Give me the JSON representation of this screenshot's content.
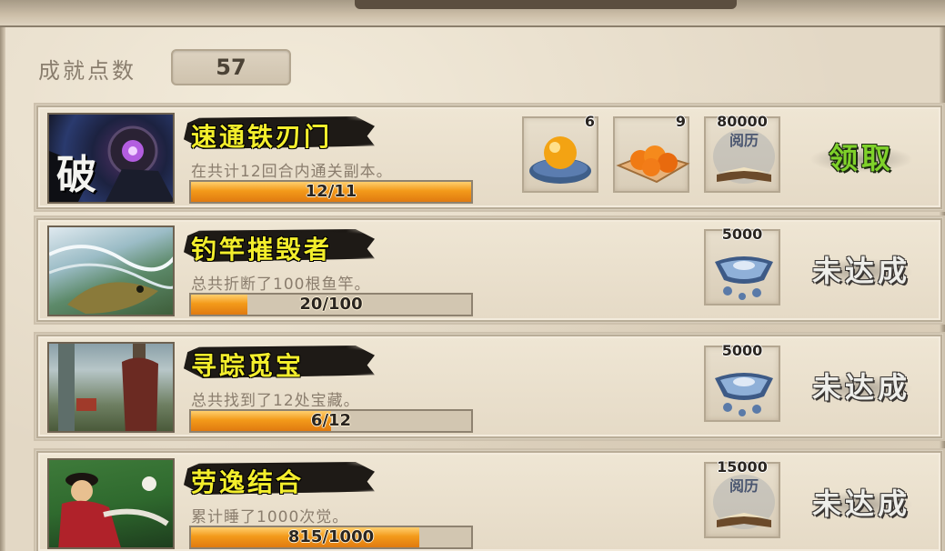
{
  "header": {
    "points_label": "成就点数",
    "points_value": "57"
  },
  "achievements": [
    {
      "title": "速通铁刃门",
      "description": "在共计12回合内通关副本。",
      "progress_text": "12/11",
      "progress": 1.0,
      "rewards": [
        {
          "icon": "orange-orb-icon",
          "count": "6"
        },
        {
          "icon": "oranges-plate-icon",
          "count": "9"
        },
        {
          "icon": "experience-book-icon",
          "count": "80000"
        }
      ],
      "action_label": "领取",
      "action_state": "claimable",
      "portrait_text": "破"
    },
    {
      "title": "钓竿摧毁者",
      "description": "总共折断了100根鱼竿。",
      "progress_text": "20/100",
      "progress": 0.2,
      "rewards": [
        {
          "icon": "silver-ingot-icon",
          "count": "5000"
        }
      ],
      "action_label": "未达成",
      "action_state": "locked"
    },
    {
      "title": "寻踪觅宝",
      "description": "总共找到了12处宝藏。",
      "progress_text": "6/12",
      "progress": 0.5,
      "rewards": [
        {
          "icon": "silver-ingot-icon",
          "count": "5000"
        }
      ],
      "action_label": "未达成",
      "action_state": "locked"
    },
    {
      "title": "劳逸结合",
      "description": "累计睡了1000次觉。",
      "progress_text": "815/1000",
      "progress": 0.815,
      "rewards": [
        {
          "icon": "experience-book-icon",
          "count": "15000"
        }
      ],
      "action_label": "未达成",
      "action_state": "locked"
    }
  ],
  "book_icon_text": "阅历",
  "colors": {
    "title_yellow": "#f3ee2c",
    "progress_orange": "#f39a1a",
    "claim_green": "#7fd12a"
  }
}
